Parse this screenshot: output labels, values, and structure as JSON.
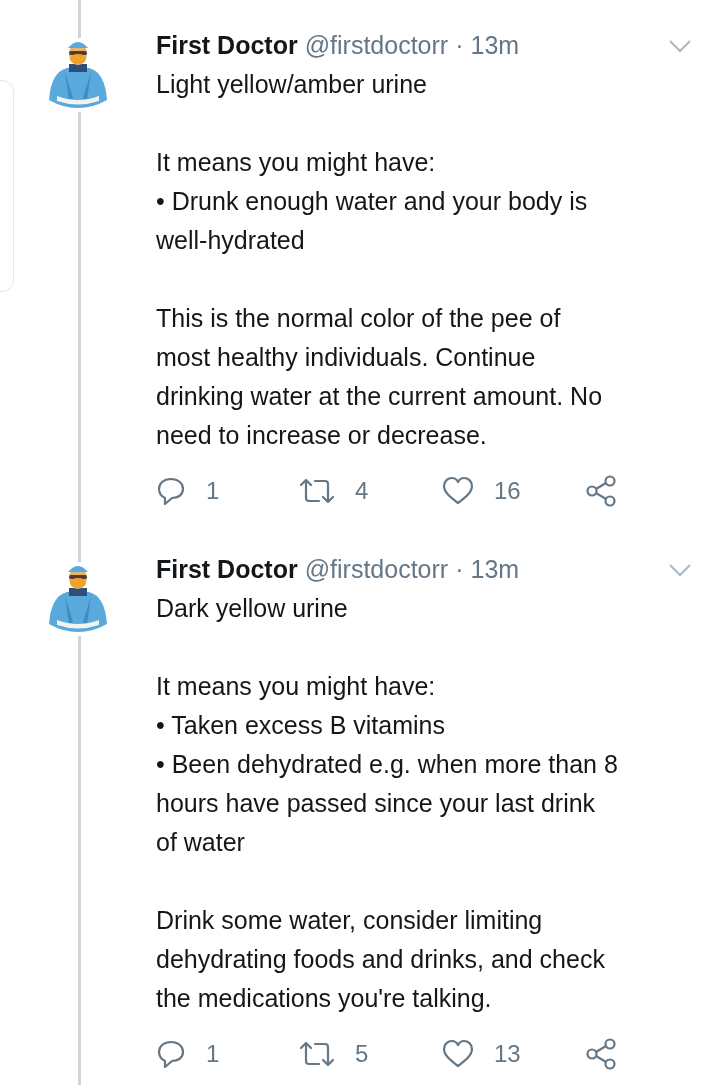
{
  "tweets": [
    {
      "author": {
        "name": "First Doctor",
        "handle": "@firstdoctorr"
      },
      "separator": "·",
      "time": "13m",
      "paragraphs": [
        [
          "Light yellow/amber urine"
        ],
        [
          "It means you might have:",
          "• Drunk enough water and your body is",
          "well-hydrated"
        ],
        [
          "This is the normal color of the pee of",
          "most healthy individuals. Continue",
          "drinking water at the current amount. No",
          "need to increase or decrease."
        ]
      ],
      "replies": "1",
      "retweets": "4",
      "likes": "16"
    },
    {
      "author": {
        "name": "First Doctor",
        "handle": "@firstdoctorr"
      },
      "separator": "·",
      "time": "13m",
      "paragraphs": [
        [
          "Dark yellow urine"
        ],
        [
          "It means you might have:",
          "• Taken excess B vitamins",
          "• Been dehydrated e.g. when more than 8",
          "hours have passed since your last drink",
          "of water"
        ],
        [
          "Drink some water, consider limiting",
          "dehydrating foods and drinks, and check",
          "the medications you're talking."
        ]
      ],
      "replies": "1",
      "retweets": "5",
      "likes": "13"
    }
  ]
}
